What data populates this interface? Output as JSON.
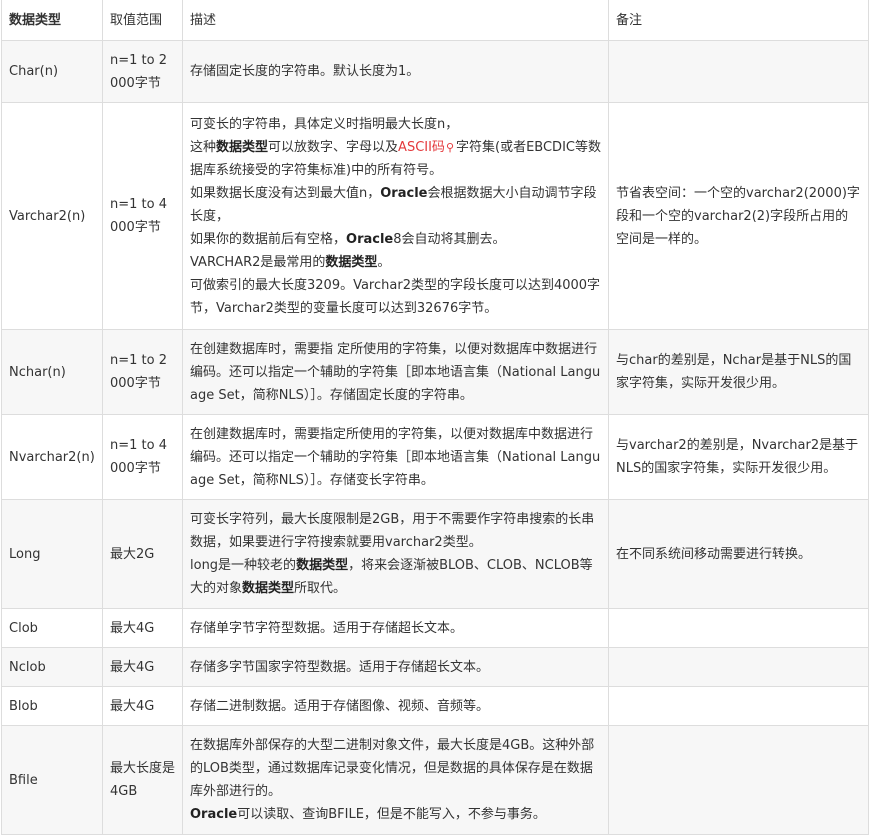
{
  "headers": [
    "数据类型",
    "取值范围",
    "描述",
    "备注"
  ],
  "rows": [
    {
      "type": "Char(n)",
      "range": "n=1 to 2000字节",
      "desc": [
        [
          {
            "t": "存储固定长度的字符串。默认长度为1。"
          }
        ]
      ],
      "note": [
        [
          {
            "t": ""
          }
        ]
      ]
    },
    {
      "type": "Varchar2(n)",
      "range": "n=1 to 4000字节",
      "desc": [
        [
          {
            "t": "可变长的字符串，具体定义时指明最大长度n，"
          }
        ],
        [
          {
            "t": "这种"
          },
          {
            "t": "数据类型",
            "b": true
          },
          {
            "t": "可以放数字、字母以及"
          },
          {
            "t": "ASCII码",
            "link": true
          },
          {
            "t": "字符集(或者EBCDIC等数据库系统接受的字符集标准)中的所有符号。"
          }
        ],
        [
          {
            "t": "如果数据长度没有达到最大值n，"
          },
          {
            "t": "Oracle",
            "b": true
          },
          {
            "t": "会根据数据大小自动调节字段长度，"
          }
        ],
        [
          {
            "t": "如果你的数据前后有空格，"
          },
          {
            "t": "Oracle",
            "b": true
          },
          {
            "t": "8会自动将其删去。"
          }
        ],
        [
          {
            "t": "VARCHAR2是最常用的"
          },
          {
            "t": "数据类型",
            "b": true
          },
          {
            "t": "。"
          }
        ],
        [
          {
            "t": "可做索引的最大长度3209。Varchar2类型的字段长度可以达到4000字节，Varchar2类型的变量长度可以达到32676字节。"
          }
        ]
      ],
      "note": [
        [
          {
            "t": "节省表空间：一个空的varchar2(2000)字段和一个空的varchar2(2)字段所占用的空间是一样的。"
          }
        ]
      ]
    },
    {
      "type": "Nchar(n)",
      "range": "n=1 to 2000字节",
      "desc": [
        [
          {
            "t": "在创建数据库时，需要指 定所使用的字符集，以便对数据库中数据进行编码。还可以指定一个辅助的字符集［即本地语言集（National Language Set，简称NLS）］。存储固定长度的字符串。"
          }
        ]
      ],
      "note": [
        [
          {
            "t": " 与char的差别是，Nchar是基于NLS的国家字符集，实际开发很少用。"
          }
        ]
      ]
    },
    {
      "type": "Nvarchar2(n)",
      "range": "n=1 to 4000字节",
      "desc": [
        [
          {
            "t": "在创建数据库时，需要指定所使用的字符集，以便对数据库中数据进行编码。还可以指定一个辅助的字符集［即本地语言集（National Language Set，简称NLS）］。存储变长字符串。"
          }
        ]
      ],
      "note": [
        [
          {
            "t": " 与varchar2的差别是，Nvarchar2是基于NLS的国家字符集，实际开发很少用。"
          }
        ]
      ]
    },
    {
      "type": "Long",
      "range": "最大2G",
      "desc": [
        [
          {
            "t": "可变长字符列，最大长度限制是2GB，用于不需要作字符串搜索的长串数据，如果要进行字符搜索就要用varchar2类型。"
          }
        ],
        [
          {
            "t": "long是一种较老的"
          },
          {
            "t": "数据类型",
            "b": true
          },
          {
            "t": "，将来会逐渐被BLOB、CLOB、NCLOB等大的对象"
          },
          {
            "t": "数据类型",
            "b": true
          },
          {
            "t": "所取代。"
          }
        ]
      ],
      "note": [
        [
          {
            "t": "在不同系统间移动需要进行转换。"
          }
        ]
      ]
    },
    {
      "type": "Clob",
      "range": "最大4G",
      "desc": [
        [
          {
            "t": "存储单字节字符型数据。适用于存储超长文本。"
          }
        ]
      ],
      "note": [
        [
          {
            "t": ""
          }
        ]
      ]
    },
    {
      "type": "Nclob",
      "range": "最大4G",
      "desc": [
        [
          {
            "t": "存储多字节国家字符型数据。适用于存储超长文本。"
          }
        ]
      ],
      "note": [
        [
          {
            "t": ""
          }
        ]
      ]
    },
    {
      "type": "Blob",
      "range": "最大4G",
      "desc": [
        [
          {
            "t": "存储二进制数据。适用于存储图像、视频、音频等。"
          }
        ]
      ],
      "note": [
        [
          {
            "t": ""
          }
        ]
      ]
    },
    {
      "type": "Bfile",
      "range": "最大长度是4GB",
      "desc": [
        [
          {
            "t": "在数据库外部保存的大型二进制对象文件，最大长度是4GB。这种外部的LOB类型，通过数据库记录变化情况，但是数据的具体保存是在数据库外部进行的。"
          }
        ],
        [
          {
            "t": "Oracle",
            "b": true
          },
          {
            "t": "可以读取、查询BFILE，但是不能写入，不参与事务。"
          }
        ]
      ],
      "note": [
        [
          {
            "t": ""
          }
        ]
      ]
    }
  ]
}
